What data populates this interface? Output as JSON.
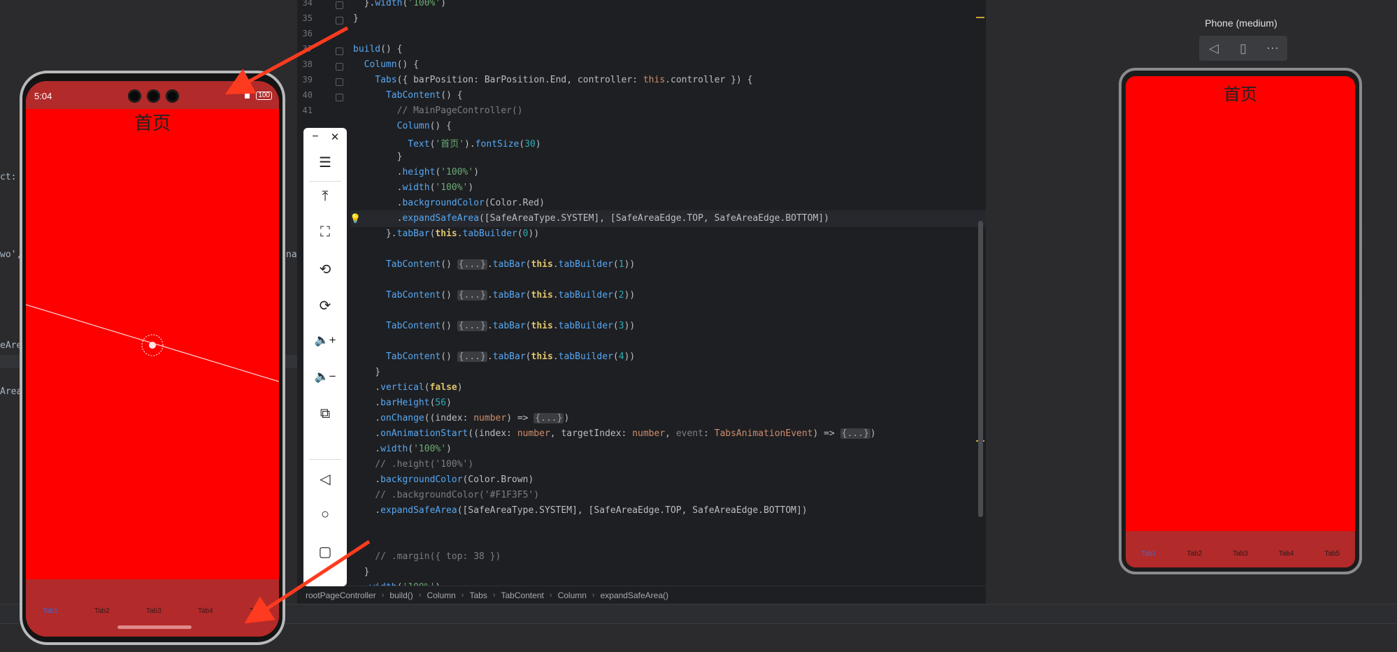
{
  "left_fragments": [
    "ct: '",
    "wo',",
    "eAre",
    "Area",
    "na"
  ],
  "editor": {
    "lines": [
      {
        "n": "34",
        "parts": [
          [
            "",
            "  }."
          ],
          [
            "fn",
            "width"
          ],
          [
            "",
            "("
          ],
          [
            "st",
            "'100%'"
          ],
          [
            "",
            ")"
          ]
        ]
      },
      {
        "n": "35",
        "parts": [
          [
            "",
            "}"
          ]
        ]
      },
      {
        "n": "36",
        "parts": []
      },
      {
        "n": "37",
        "parts": [
          [
            "fn",
            "build"
          ],
          [
            "",
            "() {"
          ]
        ]
      },
      {
        "n": "38",
        "parts": [
          [
            "",
            "  "
          ],
          [
            "fn",
            "Column"
          ],
          [
            "",
            "() {"
          ]
        ]
      },
      {
        "n": "39",
        "parts": [
          [
            "",
            "    "
          ],
          [
            "fn",
            "Tabs"
          ],
          [
            "",
            "({ "
          ],
          [
            "",
            "barPosition"
          ],
          [
            "",
            ": "
          ],
          [
            "",
            "BarPosition.End"
          ],
          [
            "",
            ", "
          ],
          [
            "",
            "controller"
          ],
          [
            "",
            ": "
          ],
          [
            "kw",
            "this"
          ],
          [
            "",
            ".controller }) {"
          ]
        ]
      },
      {
        "n": "40",
        "parts": [
          [
            "",
            "      "
          ],
          [
            "fn",
            "TabContent"
          ],
          [
            "",
            "() {"
          ]
        ]
      },
      {
        "n": "41",
        "parts": [
          [
            "",
            "        "
          ],
          [
            "cm",
            "// MainPageController()"
          ]
        ]
      },
      {
        "n": "",
        "parts": [
          [
            "",
            "        "
          ],
          [
            "fn",
            "Column"
          ],
          [
            "",
            "() {"
          ]
        ]
      },
      {
        "n": "",
        "parts": [
          [
            "",
            "          "
          ],
          [
            "fn",
            "Text"
          ],
          [
            "",
            "("
          ],
          [
            "st",
            "'首页'"
          ],
          [
            "",
            ")."
          ],
          [
            "fn",
            "fontSize"
          ],
          [
            "",
            "("
          ],
          [
            "nu",
            "30"
          ],
          [
            "",
            ")"
          ]
        ]
      },
      {
        "n": "",
        "parts": [
          [
            "",
            "        }"
          ]
        ]
      },
      {
        "n": "",
        "parts": [
          [
            "",
            "        ."
          ],
          [
            "fn",
            "height"
          ],
          [
            "",
            "("
          ],
          [
            "st",
            "'100%'"
          ],
          [
            "",
            ")"
          ]
        ]
      },
      {
        "n": "",
        "parts": [
          [
            "",
            "        ."
          ],
          [
            "fn",
            "width"
          ],
          [
            "",
            "("
          ],
          [
            "st",
            "'100%'"
          ],
          [
            "",
            ")"
          ]
        ]
      },
      {
        "n": "",
        "parts": [
          [
            "",
            "        ."
          ],
          [
            "fn",
            "backgroundColor"
          ],
          [
            "",
            "(Color.Red)"
          ]
        ]
      },
      {
        "n": "",
        "parts": [
          [
            "",
            "        ."
          ],
          [
            "fn",
            "expandSafeArea"
          ],
          [
            "",
            "([SafeAreaType.SYSTEM], [SafeAreaEdge.TOP, SafeAreaEdge.BOTTOM])"
          ]
        ]
      },
      {
        "n": "",
        "parts": [
          [
            "",
            "      }."
          ],
          [
            "fn",
            "tabBar"
          ],
          [
            "",
            "("
          ],
          [
            "th",
            "this"
          ],
          [
            "",
            "."
          ],
          [
            "fn",
            "tabBuilder"
          ],
          [
            "",
            "("
          ],
          [
            "nu",
            "0"
          ],
          [
            "",
            "))"
          ]
        ]
      },
      {
        "n": "",
        "parts": []
      },
      {
        "n": "",
        "parts": [
          [
            "",
            "      "
          ],
          [
            "fn",
            "TabContent"
          ],
          [
            "",
            "() "
          ],
          [
            "ellip",
            "{...}"
          ],
          [
            "",
            "."
          ],
          [
            "fn",
            "tabBar"
          ],
          [
            "",
            "("
          ],
          [
            "th",
            "this"
          ],
          [
            "",
            "."
          ],
          [
            "fn",
            "tabBuilder"
          ],
          [
            "",
            "("
          ],
          [
            "nu",
            "1"
          ],
          [
            "",
            "))"
          ]
        ]
      },
      {
        "n": "",
        "parts": []
      },
      {
        "n": "",
        "parts": [
          [
            "",
            "      "
          ],
          [
            "fn",
            "TabContent"
          ],
          [
            "",
            "() "
          ],
          [
            "ellip",
            "{...}"
          ],
          [
            "",
            "."
          ],
          [
            "fn",
            "tabBar"
          ],
          [
            "",
            "("
          ],
          [
            "th",
            "this"
          ],
          [
            "",
            "."
          ],
          [
            "fn",
            "tabBuilder"
          ],
          [
            "",
            "("
          ],
          [
            "nu",
            "2"
          ],
          [
            "",
            "))"
          ]
        ]
      },
      {
        "n": "",
        "parts": []
      },
      {
        "n": "",
        "parts": [
          [
            "",
            "      "
          ],
          [
            "fn",
            "TabContent"
          ],
          [
            "",
            "() "
          ],
          [
            "ellip",
            "{...}"
          ],
          [
            "",
            "."
          ],
          [
            "fn",
            "tabBar"
          ],
          [
            "",
            "("
          ],
          [
            "th",
            "this"
          ],
          [
            "",
            "."
          ],
          [
            "fn",
            "tabBuilder"
          ],
          [
            "",
            "("
          ],
          [
            "nu",
            "3"
          ],
          [
            "",
            "))"
          ]
        ]
      },
      {
        "n": "",
        "parts": []
      },
      {
        "n": "",
        "parts": [
          [
            "",
            "      "
          ],
          [
            "fn",
            "TabContent"
          ],
          [
            "",
            "() "
          ],
          [
            "ellip",
            "{...}"
          ],
          [
            "",
            "."
          ],
          [
            "fn",
            "tabBar"
          ],
          [
            "",
            "("
          ],
          [
            "th",
            "this"
          ],
          [
            "",
            "."
          ],
          [
            "fn",
            "tabBuilder"
          ],
          [
            "",
            "("
          ],
          [
            "nu",
            "4"
          ],
          [
            "",
            "))"
          ]
        ]
      },
      {
        "n": "",
        "parts": [
          [
            "",
            "    }"
          ]
        ]
      },
      {
        "n": "",
        "parts": [
          [
            "",
            "    ."
          ],
          [
            "fn",
            "vertical"
          ],
          [
            "",
            "("
          ],
          [
            "th",
            "false"
          ],
          [
            "",
            ")"
          ]
        ]
      },
      {
        "n": "",
        "parts": [
          [
            "",
            "    ."
          ],
          [
            "fn",
            "barHeight"
          ],
          [
            "",
            "("
          ],
          [
            "nu",
            "56"
          ],
          [
            "",
            ")"
          ]
        ]
      },
      {
        "n": "",
        "parts": [
          [
            "",
            "    ."
          ],
          [
            "fn",
            "onChange"
          ],
          [
            "",
            "(("
          ],
          [
            "",
            "index"
          ],
          [
            "",
            ": "
          ],
          [
            "kw",
            "number"
          ],
          [
            "",
            ") => "
          ],
          [
            "ellip",
            "{...}"
          ],
          [
            "",
            ")"
          ]
        ]
      },
      {
        "n": "",
        "parts": [
          [
            "",
            "    ."
          ],
          [
            "fn",
            "onAnimationStart"
          ],
          [
            "",
            "(("
          ],
          [
            "",
            "index"
          ],
          [
            "",
            ": "
          ],
          [
            "kw",
            "number"
          ],
          [
            "",
            ", targetIndex: "
          ],
          [
            "kw",
            "number"
          ],
          [
            "",
            ", "
          ],
          [
            "cm",
            "event"
          ],
          [
            "",
            ": "
          ],
          [
            "kw",
            "TabsAnimationEvent"
          ],
          [
            "",
            ") => "
          ],
          [
            "ellip",
            "{...}"
          ],
          [
            "",
            ")"
          ]
        ]
      },
      {
        "n": "",
        "parts": [
          [
            "",
            "    ."
          ],
          [
            "fn",
            "width"
          ],
          [
            "",
            "("
          ],
          [
            "st",
            "'100%'"
          ],
          [
            "",
            ")"
          ]
        ]
      },
      {
        "n": "",
        "parts": [
          [
            "",
            "    "
          ],
          [
            "cm",
            "// .height('100%')"
          ]
        ]
      },
      {
        "n": "",
        "parts": [
          [
            "",
            "    ."
          ],
          [
            "fn",
            "backgroundColor"
          ],
          [
            "",
            "(Color.Brown)"
          ]
        ]
      },
      {
        "n": "",
        "parts": [
          [
            "",
            "    "
          ],
          [
            "cm",
            "// .backgroundColor('#F1F3F5')"
          ]
        ]
      },
      {
        "n": "",
        "parts": [
          [
            "",
            "    ."
          ],
          [
            "fn",
            "expandSafeArea"
          ],
          [
            "",
            "([SafeAreaType.SYSTEM], [SafeAreaEdge.TOP, SafeAreaEdge.BOTTOM])"
          ]
        ]
      },
      {
        "n": "",
        "parts": []
      },
      {
        "n": "",
        "parts": []
      },
      {
        "n": "",
        "parts": [
          [
            "",
            "    "
          ],
          [
            "cm",
            "// .margin({ top: 38 })"
          ]
        ]
      },
      {
        "n": "",
        "parts": [
          [
            "",
            "  }"
          ]
        ]
      },
      {
        "n": "",
        "parts": [
          [
            "",
            "  ."
          ],
          [
            "fn",
            "width"
          ],
          [
            "",
            "("
          ],
          [
            "st",
            "'100%'"
          ],
          [
            "",
            ")"
          ]
        ]
      }
    ]
  },
  "breadcrumb": [
    "rootPageController",
    "build()",
    "Column",
    "Tabs",
    "TabContent",
    "Column",
    "expandSafeArea()"
  ],
  "preview": {
    "title": "Phone (medium)",
    "page_title": "首页",
    "tabs": [
      "Tab1",
      "Tab2",
      "Tab3",
      "Tab4",
      "Tab5"
    ],
    "active_tab": 0
  },
  "emulator": {
    "time": "5:04",
    "battery": "100",
    "page_title": "首页",
    "tabs": [
      "Tab1",
      "Tab2",
      "Tab3",
      "Tab4",
      "Ta"
    ],
    "active_tab": 0
  },
  "emulator_toolbar": {
    "minimize": "−",
    "close": "✕",
    "icons": [
      "menu-icon",
      "pin-top-icon",
      "crop-icon",
      "rotate-left-icon",
      "rotate-right-icon",
      "volume-up-icon",
      "volume-down-icon",
      "shake-icon",
      "back-icon",
      "home-icon",
      "recents-icon"
    ]
  },
  "colors": {
    "screen_red": "#ff0000",
    "tabbar_brown": "#b22a2a",
    "active_tab": "#3a6bd8",
    "arrow_red": "#ff3b1f"
  }
}
